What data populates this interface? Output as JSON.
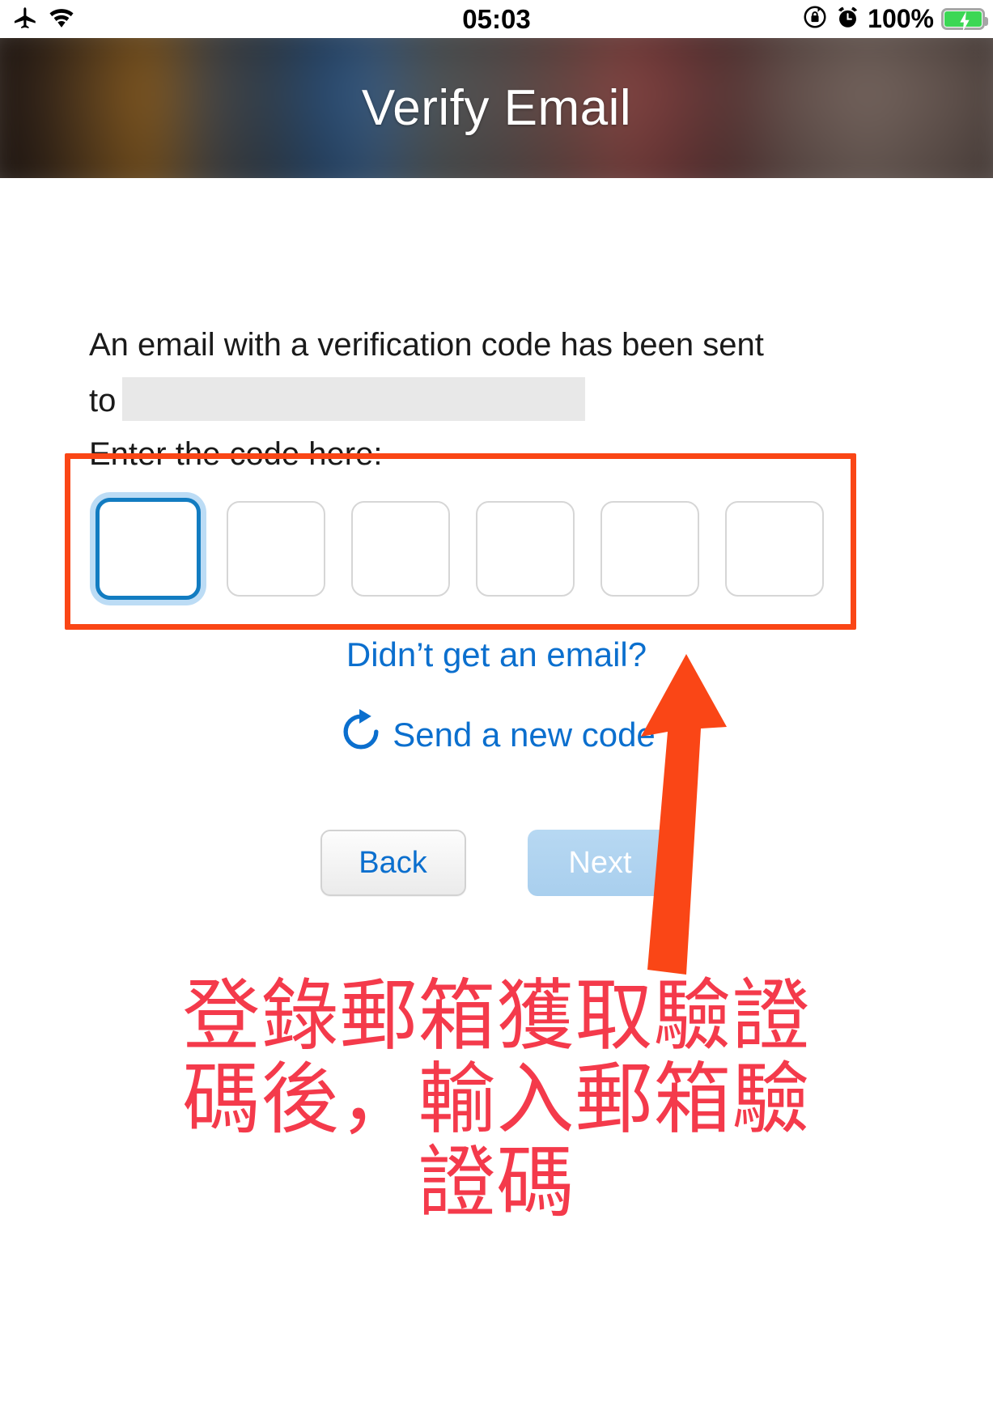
{
  "statusbar": {
    "time": "05:03",
    "battery_percent": "100%",
    "icons": {
      "airplane": "airplane-mode-icon",
      "wifi": "wifi-icon",
      "rotation_lock": "rotation-lock-icon",
      "alarm": "alarm-clock-icon",
      "battery": "battery-charging-icon"
    }
  },
  "navbar": {
    "title": "Verify Email"
  },
  "main": {
    "description_line": "An email with a verification code has been sent to",
    "redacted_email": "",
    "enter_code_label": "Enter the code here:",
    "code_boxes": [
      {
        "value": "",
        "focused": true
      },
      {
        "value": "",
        "focused": false
      },
      {
        "value": "",
        "focused": false
      },
      {
        "value": "",
        "focused": false
      },
      {
        "value": "",
        "focused": false
      },
      {
        "value": "",
        "focused": false
      }
    ],
    "didnt_get_email_link": "Didn’t get an email?",
    "send_new_code_link": "Send a new code",
    "refresh_icon": "refresh-icon",
    "buttons": {
      "back": "Back",
      "next": "Next"
    }
  },
  "annotation": {
    "highlight_box": "code-input-highlight",
    "arrow": "up-arrow-annotation",
    "text_lines": [
      "登錄郵箱獲取驗證",
      "碼後，輸入郵箱驗",
      "證碼"
    ]
  },
  "colors": {
    "link_blue": "#0b6fce",
    "focus_blue": "#127cc1",
    "annotation_orange": "#fa4616",
    "annotation_red": "#f43a4b",
    "battery_green": "#3cd755",
    "next_button_blue": "#a9cfee"
  }
}
